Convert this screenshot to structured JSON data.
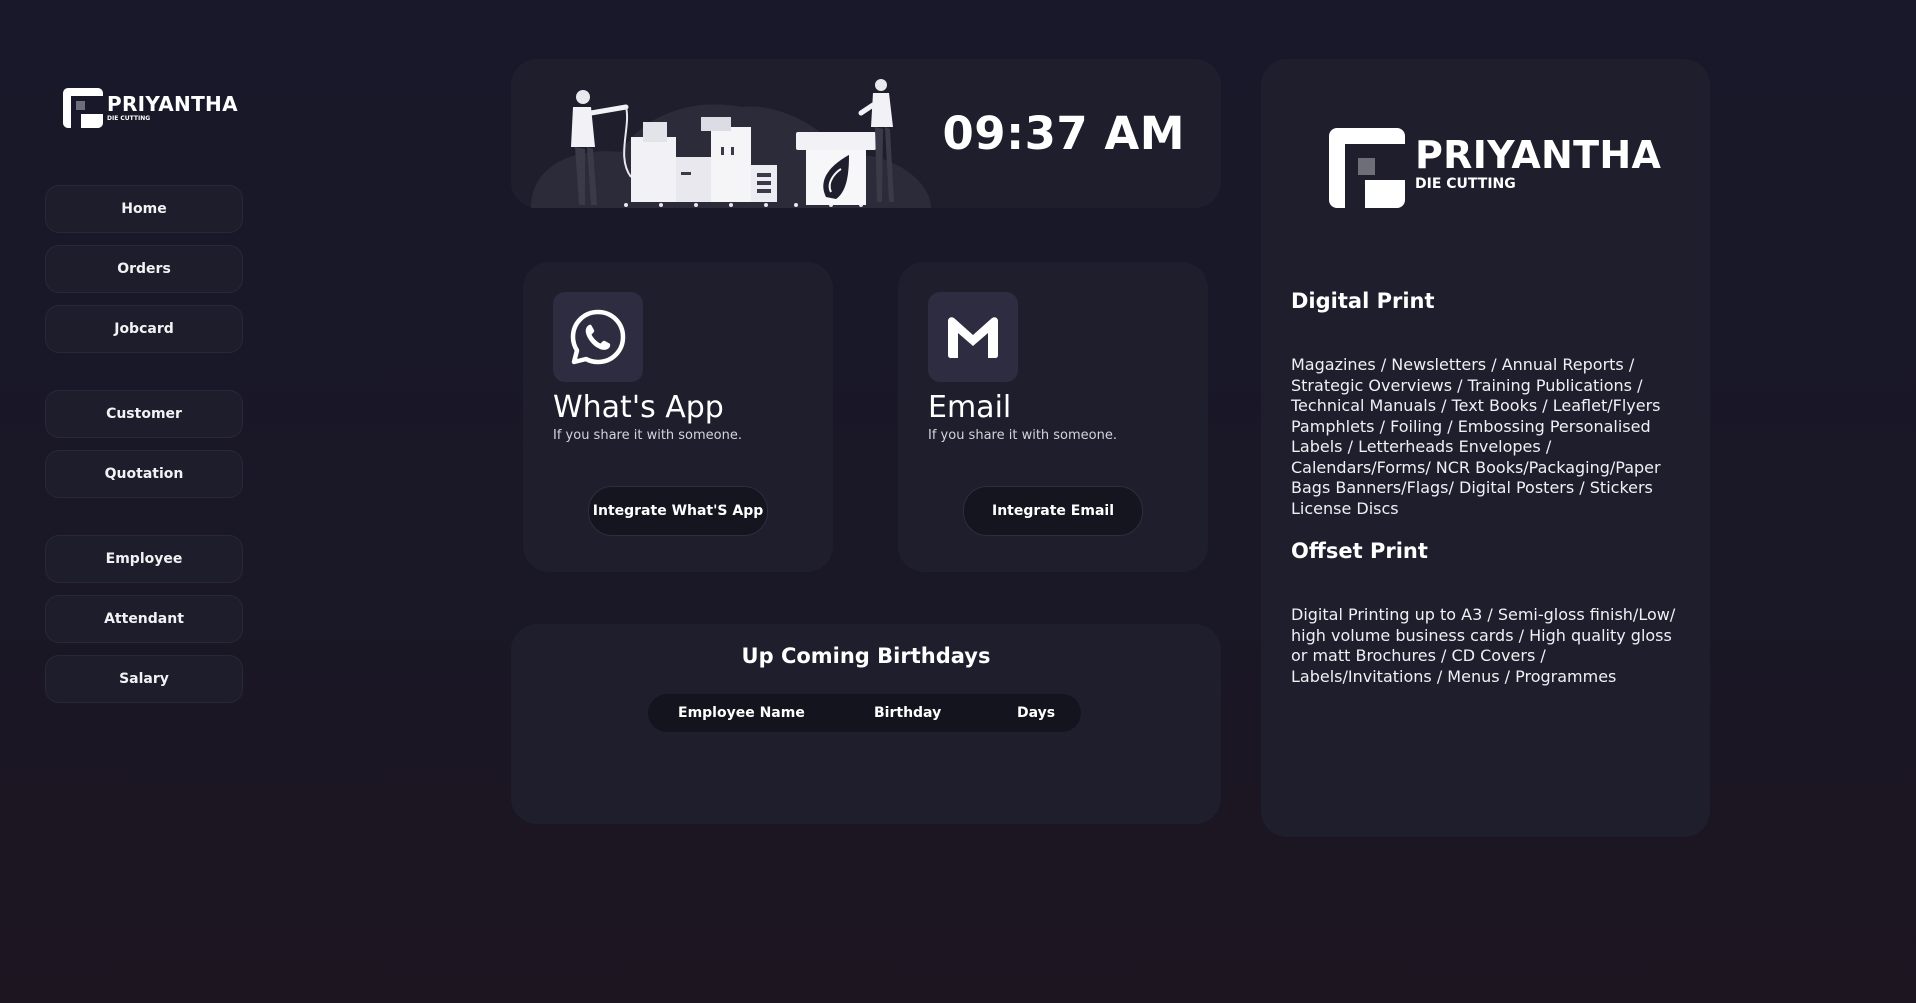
{
  "brand": {
    "name": "PRIYANTHA",
    "subtitle": "DIE CUTTING"
  },
  "sidebar": {
    "items": [
      {
        "label": "Home"
      },
      {
        "label": "Orders"
      },
      {
        "label": "Jobcard"
      },
      {
        "label": "Customer"
      },
      {
        "label": "Quotation"
      },
      {
        "label": "Employee"
      },
      {
        "label": "Attendant"
      },
      {
        "label": "Salary"
      }
    ]
  },
  "header": {
    "time": "09:37 AM",
    "illustration": "printing-press-illustration"
  },
  "cards": {
    "whatsapp": {
      "icon": "whatsapp-icon",
      "title": "What's App",
      "subtitle": "If you share it with someone.",
      "button": "Integrate What'S App"
    },
    "email": {
      "icon": "gmail-icon",
      "title": "Email",
      "subtitle": "If you share it with someone.",
      "button": "Integrate Email"
    }
  },
  "birthdays": {
    "title": "Up Coming Birthdays",
    "columns": [
      "Employee Name",
      "Birthday",
      "Days"
    ],
    "rows": []
  },
  "info": {
    "digital_title": "Digital Print",
    "digital_body": "Magazines / Newsletters / Annual Reports / Strategic Overviews / Training Publications / Technical Manuals / Text Books / Leaflet/Flyers Pamphlets / Foiling / Embossing Personalised Labels / Letterheads Envelopes / Calendars/Forms/ NCR Books/Packaging/Paper Bags Banners/Flags/ Digital Posters / Stickers License Discs",
    "offset_title": "Offset Print",
    "offset_body": "Digital Printing up to A3 / Semi-gloss finish/Low/ high volume business cards / High quality gloss or matt Brochures / CD Covers / Labels/Invitations / Menus / Programmes"
  },
  "colors": {
    "background": "#18182a",
    "panel": "#1e1e2c",
    "icon_tile": "#2d2c40",
    "button_dark": "#15151f",
    "text": "#ffffff"
  }
}
